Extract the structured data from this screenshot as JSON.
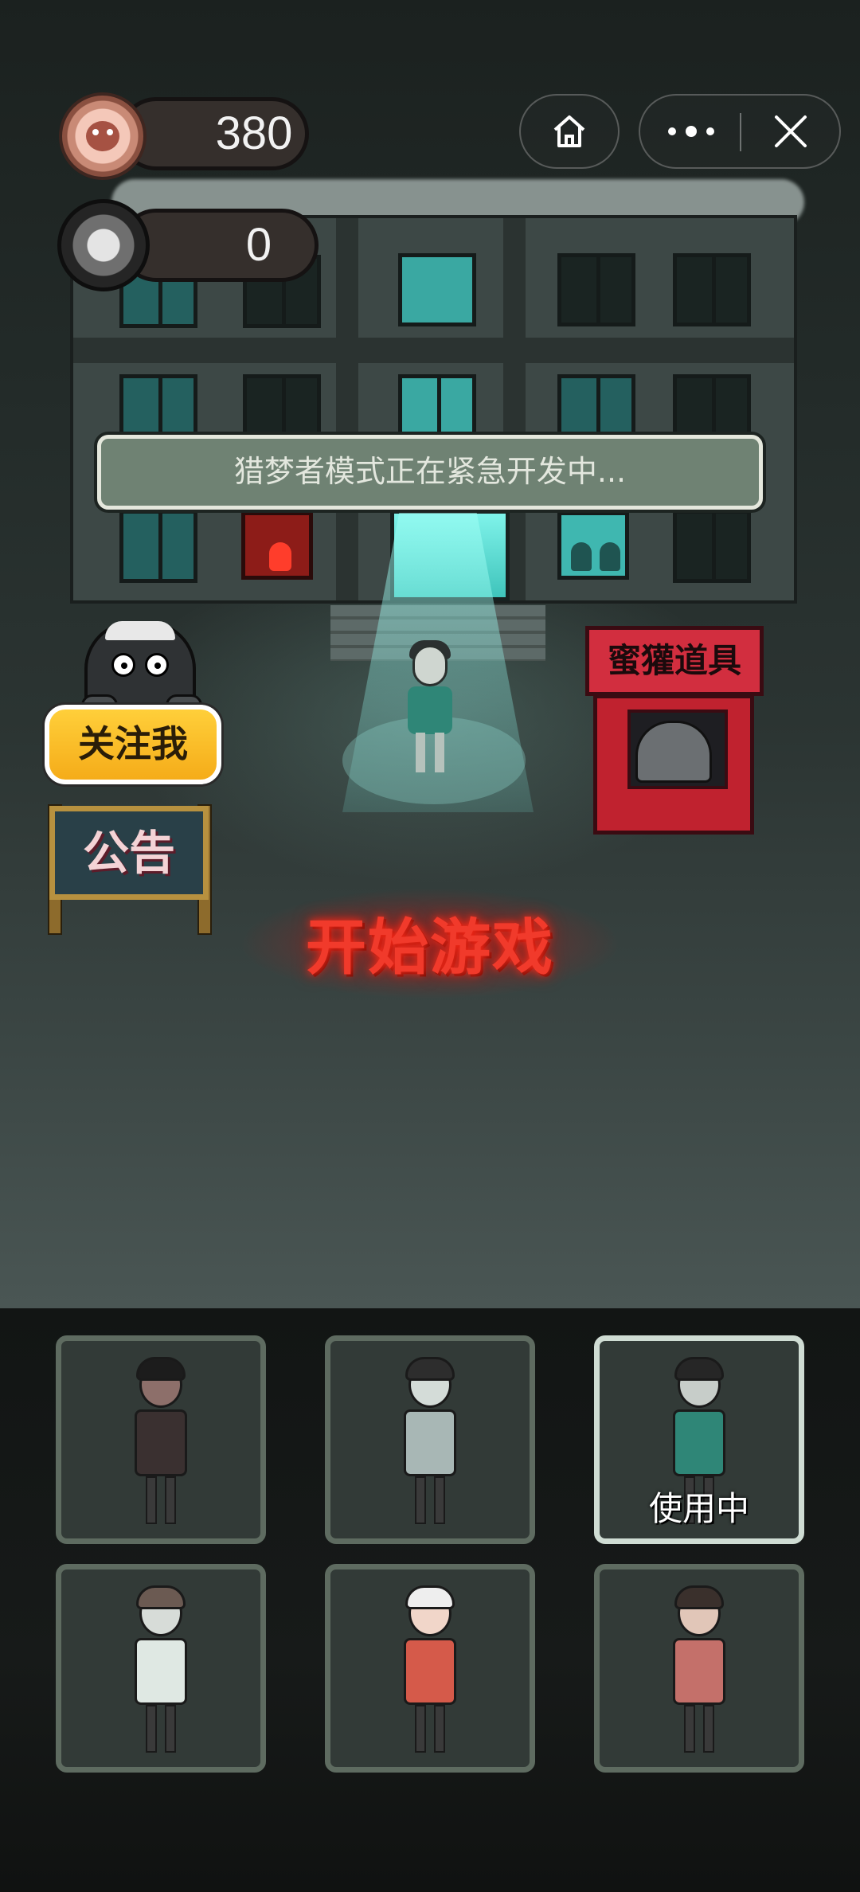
{
  "hud": {
    "coins": "380",
    "tokens": "0"
  },
  "mini_program": {
    "home_icon": "home-icon",
    "more_icon": "more-dots-icon",
    "close_icon": "close-icon"
  },
  "banner": {
    "text": "猎梦者模式正在紧急开发中..."
  },
  "side": {
    "follow_label": "关注我",
    "notice_label": "公告"
  },
  "shop": {
    "label": "蜜獾道具"
  },
  "start": {
    "label": "开始游戏"
  },
  "characters": {
    "in_use_label": "使用中",
    "selected_index": 2,
    "items": [
      {
        "name": "girl-with-bows",
        "skin": "#8d6f6a",
        "outfit": "#3a3030",
        "hair": "#1c1c1c"
      },
      {
        "name": "glasses-boy",
        "skin": "#d4dcd8",
        "outfit": "#a8b7b5",
        "hair": "#2d2d2d"
      },
      {
        "name": "bearded-man",
        "skin": "#c7cdc9",
        "outfit": "#2f8677",
        "hair": "#262626"
      },
      {
        "name": "bun-girl",
        "skin": "#d7dcd8",
        "outfit": "#dfe8e3",
        "hair": "#6b5a52"
      },
      {
        "name": "granny",
        "skin": "#f1d6c9",
        "outfit": "#d55a4a",
        "hair": "#eeeeee"
      },
      {
        "name": "braided-woman",
        "skin": "#e1c6b8",
        "outfit": "#c4706a",
        "hair": "#3a302c"
      }
    ]
  },
  "colors": {
    "start_red": "#f13a2b",
    "follow_yellow": "#f5ac19",
    "shop_red": "#c0222f",
    "slot_border": "#5e6b60",
    "slot_border_active": "#cfdcd3"
  }
}
